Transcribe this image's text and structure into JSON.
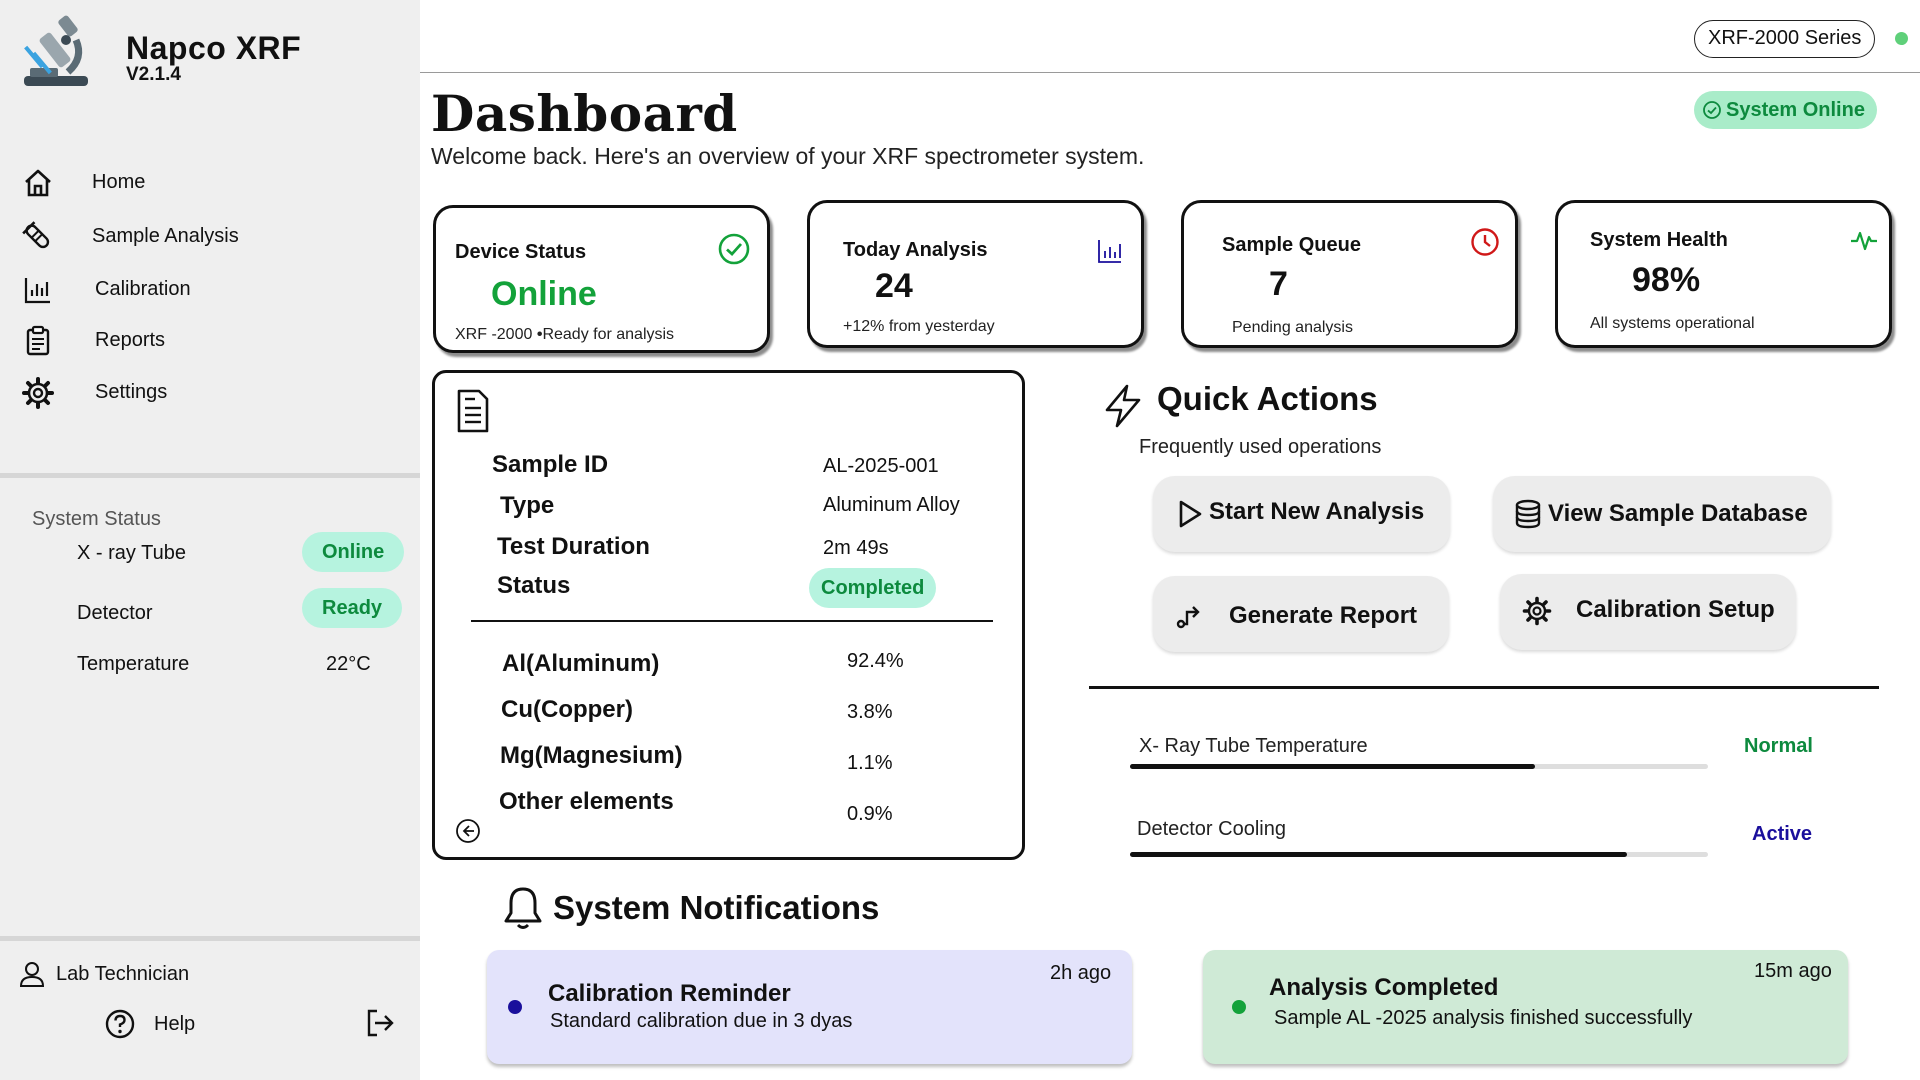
{
  "app": {
    "name": "Napco  XRF",
    "version": "V2.1.4"
  },
  "nav": {
    "items": [
      {
        "label": "Home",
        "icon": "home-icon"
      },
      {
        "label": "Sample Analysis",
        "icon": "test-tube-icon"
      },
      {
        "label": "Calibration",
        "icon": "bar-chart-icon"
      },
      {
        "label": "Reports",
        "icon": "clipboard-icon"
      },
      {
        "label": "Settings",
        "icon": "gear-icon"
      }
    ]
  },
  "system_status": {
    "title": "System Status",
    "xray_tube": {
      "label": "X - ray Tube",
      "value": "Online"
    },
    "detector": {
      "label": "Detector",
      "value": "Ready"
    },
    "temperature": {
      "label": "Temperature",
      "value": "22°C"
    }
  },
  "user": {
    "name": "Lab Technician",
    "help_label": "Help"
  },
  "topbar": {
    "series": "XRF-2000 Series",
    "indicator_color": "#5fd07a"
  },
  "header": {
    "title": "Dashboard",
    "subtitle": "Welcome back. Here's an overview of your XRF spectrometer system.",
    "status_badge": "System Online"
  },
  "cards": {
    "device": {
      "title": "Device Status",
      "value": "Online",
      "sub_model": "XRF -2000",
      "sub_text": "Ready for analysis"
    },
    "today": {
      "title": "Today Analysis",
      "value": "24",
      "sub": "+12% from yesterday"
    },
    "queue": {
      "title": "Sample Queue",
      "value": "7",
      "sub": "Pending analysis"
    },
    "health": {
      "title": "System Health",
      "value": "98%",
      "sub": "All systems operational"
    }
  },
  "sample": {
    "id_label": "Sample ID",
    "id_value": "AL-2025-001",
    "type_label": "Type",
    "type_value": "Aluminum Alloy",
    "duration_label": "Test Duration",
    "duration_value": "2m 49s",
    "status_label": "Status",
    "status_value": "Completed",
    "elements": [
      {
        "name": "Al(Aluminum)",
        "value": "92.4%"
      },
      {
        "name": "Cu(Copper)",
        "value": "3.8%"
      },
      {
        "name": "Mg(Magnesium)",
        "value": "1.1%"
      },
      {
        "name": "Other elements",
        "value": "0.9%"
      }
    ]
  },
  "quick_actions": {
    "title": "Quick Actions",
    "subtitle": "Frequently used operations",
    "start": "Start New Analysis",
    "database": "View Sample Database",
    "report": "Generate Report",
    "calibration": "Calibration Setup"
  },
  "metrics": [
    {
      "label": "X- Ray Tube Temperature",
      "state": "Normal",
      "state_color": "#0d8a3e",
      "level": 0.7
    },
    {
      "label": "Detector Cooling",
      "state": "Active",
      "state_color": "#1a0f9c",
      "level": 0.86
    }
  ],
  "notifications": {
    "title": "System Notifications",
    "items": [
      {
        "title": "Calibration Reminder",
        "message": "Standard calibration due in 3 dyas",
        "time": "2h ago",
        "bg": "#e3e3fb",
        "dot": "#1a0f9c"
      },
      {
        "title": "Analysis Completed",
        "message": "Sample AL -2025 analysis finished successfully",
        "time": "15m ago",
        "bg": "#cfead6",
        "dot": "#13a23a"
      }
    ]
  }
}
